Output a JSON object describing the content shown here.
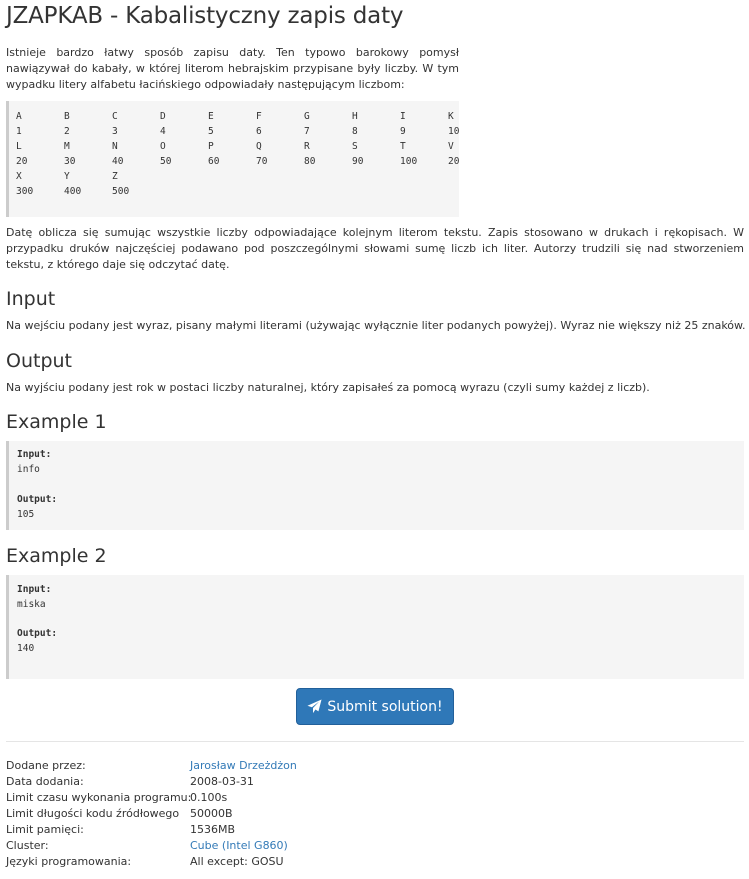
{
  "title": "JZAPKAB - Kabalistyczny zapis daty",
  "intro": "Istnieje bardzo łatwy sposób zapisu daty. Ten typowo barokowy pomysł nawiązywał do kabały, w której literom hebrajskim przypisane były liczby. W tym wypadku litery alfabetu łacińskiego odpowiadały następującym liczbom:",
  "table_rows": [
    [
      "A",
      "B",
      "C",
      "D",
      "E",
      "F",
      "G",
      "H",
      "I",
      "K"
    ],
    [
      "1",
      "2",
      "3",
      "4",
      "5",
      "6",
      "7",
      "8",
      "9",
      "10"
    ],
    [
      "L",
      "M",
      "N",
      "O",
      "P",
      "Q",
      "R",
      "S",
      "T",
      "V"
    ],
    [
      "20",
      "30",
      "40",
      "50",
      "60",
      "70",
      "80",
      "90",
      "100",
      "20"
    ],
    [
      "X",
      "Y",
      "Z"
    ],
    [
      "300",
      "400",
      "500"
    ]
  ],
  "paragraph2": "Datę oblicza się sumując wszystkie liczby odpowiadające kolejnym literom tekstu. Zapis stosowano w drukach i rękopisach. W przypadku druków najczęściej podawano pod poszczególnymi słowami sumę liczb ich liter. Autorzy trudzili się nad stworzeniem tekstu, z którego daje się odczytać datę.",
  "input_heading": "Input",
  "input_text": "Na wejściu podany jest wyraz, pisany małymi literami (używając wyłącznie liter podanych powyżej). Wyraz nie większy niż 25 znaków.",
  "output_heading": "Output",
  "output_text": "Na wyjściu podany jest rok w postaci liczby naturalnej, który zapisałeś za pomocą wyrazu (czyli sumy każdej z liczb).",
  "examples": [
    {
      "heading": "Example 1",
      "input_label": "Input:",
      "input": "info",
      "output_label": "Output:",
      "output": "105"
    },
    {
      "heading": "Example 2",
      "input_label": "Input:",
      "input": "miska",
      "output_label": "Output:",
      "output": "140"
    }
  ],
  "submit_label": "Submit solution!",
  "submit_icon": "paper-plane-icon",
  "meta": [
    {
      "key": "Dodane przez:",
      "value": "Jarosław Drzeżdżon",
      "link": true
    },
    {
      "key": "Data dodania:",
      "value": "2008-03-31",
      "link": false
    },
    {
      "key": "Limit czasu wykonania programu:",
      "value": "0.100s",
      "link": false
    },
    {
      "key": "Limit długości kodu źródłowego",
      "value": "50000B",
      "link": false
    },
    {
      "key": "Limit pamięci:",
      "value": "1536MB",
      "link": false
    },
    {
      "key": "Cluster:",
      "value": "Cube (Intel G860)",
      "link": true
    },
    {
      "key": "Języki programowania:",
      "value": "All except: GOSU",
      "link": false
    }
  ],
  "colors": {
    "link": "#337ab7",
    "button": "#2f78b8",
    "code_bg": "#f5f5f5"
  }
}
